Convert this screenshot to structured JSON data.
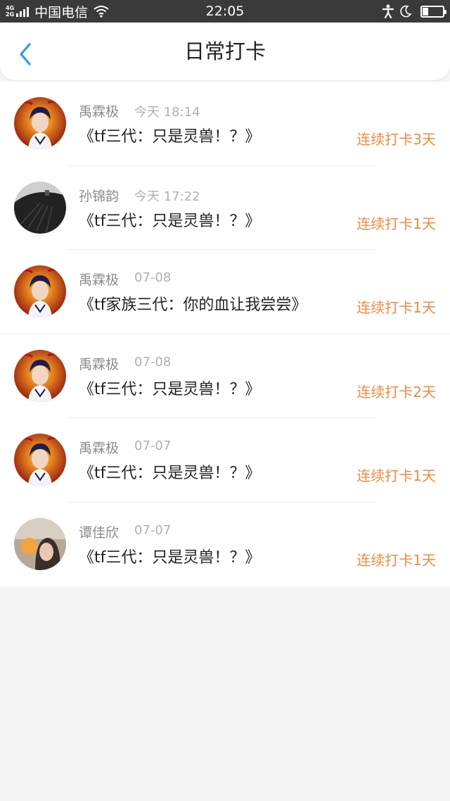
{
  "status_bar": {
    "net_top": "4G",
    "net_bottom": "2G",
    "carrier": "中国电信",
    "time": "22:05",
    "battery_level": 0.3
  },
  "header": {
    "back_icon": "chevron-left-icon",
    "title": "日常打卡",
    "accent_color": "#2b9bf0"
  },
  "streak_color": "#f08a43",
  "items": [
    {
      "user": "禹霖极",
      "time": "今天 18:14",
      "title": "《tf三代：只是灵兽！？》",
      "streak": "连续打卡3天",
      "avatar": "portrait-red-gold"
    },
    {
      "user": "孙锦韵",
      "time": "今天 17:22",
      "title": "《tf三代：只是灵兽！？》",
      "streak": "连续打卡1天",
      "avatar": "black-fan"
    },
    {
      "user": "禹霖极",
      "time": "07-08",
      "title": "《tf家族三代：你的血让我尝尝》",
      "streak": "连续打卡1天",
      "avatar": "portrait-red-gold"
    },
    {
      "user": "禹霖极",
      "time": "07-08",
      "title": "《tf三代：只是灵兽！？》",
      "streak": "连续打卡2天",
      "avatar": "portrait-red-gold"
    },
    {
      "user": "禹霖极",
      "time": "07-07",
      "title": "《tf三代：只是灵兽！？》",
      "streak": "连续打卡1天",
      "avatar": "portrait-red-gold"
    },
    {
      "user": "谭佳欣",
      "time": "07-07",
      "title": "《tf三代：只是灵兽！？》",
      "streak": "连续打卡1天",
      "avatar": "girl-photo"
    }
  ]
}
